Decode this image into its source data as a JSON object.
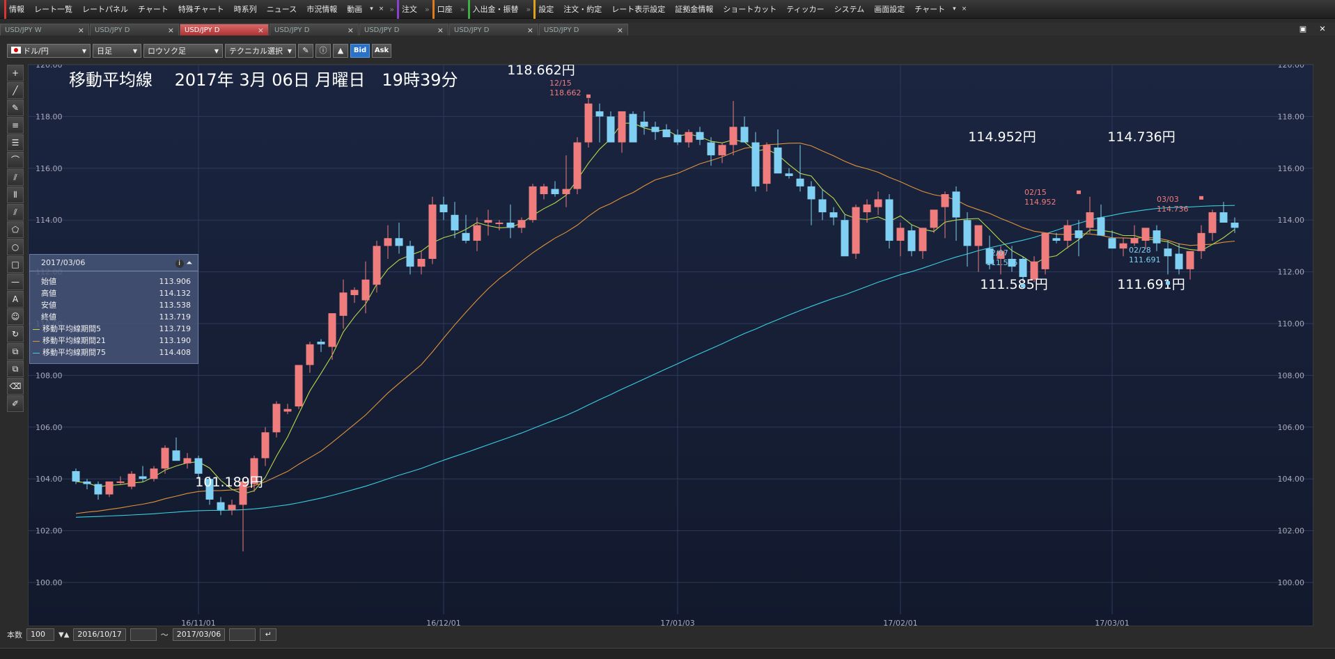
{
  "menubar": {
    "items": [
      {
        "label": "情報",
        "mark": "marked"
      },
      {
        "label": "レート一覧"
      },
      {
        "label": "レートパネル"
      },
      {
        "label": "チャート"
      },
      {
        "label": "特殊チャート"
      },
      {
        "label": "時系列"
      },
      {
        "label": "ニュース"
      },
      {
        "label": "市況情報"
      },
      {
        "label": "動画"
      }
    ],
    "group2": [
      {
        "label": "注文",
        "mark": "marked-purple"
      }
    ],
    "group3": [
      {
        "label": "口座",
        "mark": "marked-orange"
      }
    ],
    "group4": [
      {
        "label": "入出金・振替",
        "mark": "marked-green"
      }
    ],
    "group5": [
      {
        "label": "設定",
        "mark": "marked-gold"
      },
      {
        "label": "注文・約定"
      },
      {
        "label": "レート表示設定"
      },
      {
        "label": "証拠金情報"
      },
      {
        "label": "ショートカット"
      },
      {
        "label": "ティッカー"
      },
      {
        "label": "システム"
      },
      {
        "label": "画面設定"
      },
      {
        "label": "チャート"
      }
    ],
    "close_glyph": "×",
    "caret_glyph": "▾",
    "sep_glyph": "»"
  },
  "tabs": [
    {
      "label": "USD/JPY W",
      "active": false
    },
    {
      "label": "USD/JPY D",
      "active": false
    },
    {
      "label": "USD/JPY D",
      "active": true
    },
    {
      "label": "USD/JPY D",
      "active": false
    },
    {
      "label": "USD/JPY D",
      "active": false
    },
    {
      "label": "USD/JPY D",
      "active": false
    },
    {
      "label": "USD/JPY D",
      "active": false
    }
  ],
  "toolbar": {
    "pair": "ドル/円",
    "period": "日足",
    "chart_type": "ロウソク足",
    "technical": "テクニカル選択",
    "bid": "Bid",
    "ask": "Ask"
  },
  "drawtools": [
    "+",
    "╱",
    "✎",
    "≡",
    "☰",
    "⌒",
    "⫽",
    "⦀",
    "⫽",
    "⬠",
    "○",
    "□",
    "—",
    "A",
    "☺",
    "↻",
    "⧉",
    "⧉",
    "⌫",
    "✐"
  ],
  "annotations": {
    "title": "移動平均線　 2017年 3月 06日 月曜日　19時39分",
    "high1": "118.662円",
    "low1": "101.189円",
    "high2": "114.952円",
    "low2": "111.585円",
    "high3": "114.736円",
    "low3": "111.691円",
    "mark_h1_date": "12/15",
    "mark_h1_val": "118.662",
    "mark_h2_date": "02/15",
    "mark_h2_val": "114.952",
    "mark_h3_date": "03/03",
    "mark_h3_val": "114.736",
    "mark_l2_date": "02/07",
    "mark_l2_val": "111.585",
    "mark_l3_date": "02/28",
    "mark_l3_val": "111.691"
  },
  "infopanel": {
    "date": "2017/03/06",
    "rows": [
      {
        "label": "始値",
        "value": "113.906"
      },
      {
        "label": "高値",
        "value": "114.132"
      },
      {
        "label": "安値",
        "value": "113.538"
      },
      {
        "label": "終値",
        "value": "113.719"
      },
      {
        "label": "移動平均線期間5",
        "value": "113.719",
        "color": "#b8d84a"
      },
      {
        "label": "移動平均線期間21",
        "value": "113.190",
        "color": "#e0943a"
      },
      {
        "label": "移動平均線期間75",
        "value": "114.408",
        "color": "#3ad0e0"
      }
    ]
  },
  "bottombar": {
    "count_label": "本数",
    "count_value": "100",
    "from_date": "2016/10/17",
    "tilde": "～",
    "to_date": "2017/03/06"
  },
  "chart_data": {
    "type": "candlestick",
    "ylim": [
      100,
      120.5
    ],
    "yticks": [
      "120.00",
      "118.00",
      "116.00",
      "114.00",
      "112.00",
      "110.00",
      "108.00",
      "106.00",
      "104.00",
      "102.00",
      "100.00"
    ],
    "yticks_values": [
      120,
      118,
      116,
      114,
      112,
      110,
      108,
      106,
      104,
      102,
      100
    ],
    "xticks": [
      {
        "label": "16/11/01",
        "index": 11
      },
      {
        "label": "16/12/01",
        "index": 33
      },
      {
        "label": "17/01/03",
        "index": 54
      },
      {
        "label": "17/02/01",
        "index": 74
      },
      {
        "label": "17/03/01",
        "index": 93
      }
    ],
    "colors": {
      "up": "#f07d7d",
      "down": "#7fd0f2",
      "ma5": "#b8d84a",
      "ma21": "#e0943a",
      "ma75": "#3ad0e0"
    },
    "candles": [
      [
        104.3,
        104.4,
        103.8,
        103.9
      ],
      [
        103.9,
        104.0,
        103.6,
        103.8
      ],
      [
        103.8,
        103.9,
        103.2,
        103.4
      ],
      [
        103.4,
        103.9,
        103.3,
        103.9
      ],
      [
        103.9,
        104.1,
        103.8,
        103.9
      ],
      [
        103.7,
        104.3,
        103.6,
        104.2
      ],
      [
        104.1,
        104.5,
        103.9,
        104.0
      ],
      [
        104.0,
        104.5,
        103.9,
        104.4
      ],
      [
        104.4,
        105.3,
        104.2,
        105.2
      ],
      [
        105.1,
        105.6,
        104.7,
        104.7
      ],
      [
        104.6,
        105.0,
        104.4,
        104.8
      ],
      [
        104.8,
        104.9,
        104.0,
        104.2
      ],
      [
        104.0,
        104.1,
        103.0,
        103.2
      ],
      [
        103.1,
        103.3,
        102.6,
        102.8
      ],
      [
        102.8,
        103.2,
        102.6,
        103.0
      ],
      [
        103.0,
        104.0,
        101.2,
        103.9
      ],
      [
        103.8,
        104.9,
        103.5,
        104.8
      ],
      [
        104.8,
        106.0,
        104.5,
        105.8
      ],
      [
        105.8,
        107.0,
        105.6,
        106.9
      ],
      [
        106.6,
        106.9,
        106.5,
        106.7
      ],
      [
        106.8,
        108.4,
        106.7,
        108.4
      ],
      [
        108.4,
        109.3,
        108.1,
        109.2
      ],
      [
        109.3,
        109.4,
        108.9,
        109.2
      ],
      [
        109.1,
        110.4,
        108.6,
        110.4
      ],
      [
        110.3,
        111.7,
        109.8,
        111.2
      ],
      [
        111.1,
        111.4,
        110.8,
        111.3
      ],
      [
        110.9,
        112.4,
        110.4,
        111.7
      ],
      [
        111.5,
        113.2,
        111.2,
        113.0
      ],
      [
        113.0,
        113.8,
        112.5,
        113.3
      ],
      [
        113.3,
        113.9,
        112.7,
        113.0
      ],
      [
        113.0,
        113.2,
        111.9,
        112.2
      ],
      [
        112.2,
        112.8,
        111.9,
        112.5
      ],
      [
        112.5,
        114.9,
        112.3,
        114.6
      ],
      [
        114.6,
        114.9,
        114.0,
        114.3
      ],
      [
        114.2,
        114.7,
        113.3,
        113.6
      ],
      [
        113.5,
        114.2,
        113.1,
        113.2
      ],
      [
        113.2,
        114.1,
        112.8,
        113.8
      ],
      [
        113.9,
        114.4,
        113.4,
        114.0
      ],
      [
        113.9,
        114.0,
        113.6,
        113.9
      ],
      [
        113.9,
        114.6,
        113.3,
        113.7
      ],
      [
        113.7,
        114.1,
        113.5,
        114.0
      ],
      [
        114.0,
        115.4,
        113.9,
        115.3
      ],
      [
        115.0,
        115.4,
        114.8,
        115.3
      ],
      [
        115.2,
        115.5,
        114.9,
        115.0
      ],
      [
        115.0,
        116.5,
        114.5,
        115.2
      ],
      [
        115.2,
        117.2,
        115.0,
        117.0
      ],
      [
        117.0,
        118.7,
        116.8,
        118.5
      ],
      [
        118.2,
        118.5,
        117.0,
        118.0
      ],
      [
        118.0,
        118.2,
        117.4,
        117.0
      ],
      [
        117.0,
        117.4,
        116.6,
        118.2
      ],
      [
        118.1,
        118.2,
        117.2,
        117.0
      ],
      [
        117.8,
        118.2,
        117.3,
        117.6
      ],
      [
        117.6,
        117.8,
        117.1,
        117.4
      ],
      [
        117.5,
        117.7,
        117.3,
        117.2
      ],
      [
        117.3,
        117.5,
        116.9,
        117.0
      ],
      [
        117.0,
        117.5,
        116.8,
        117.4
      ],
      [
        117.4,
        117.6,
        116.9,
        117.1
      ],
      [
        117.0,
        117.2,
        116.1,
        116.5
      ],
      [
        116.5,
        117.0,
        116.2,
        116.9
      ],
      [
        116.9,
        118.6,
        116.5,
        117.6
      ],
      [
        117.6,
        118.0,
        117.1,
        117.0
      ],
      [
        117.0,
        117.4,
        115.1,
        115.3
      ],
      [
        115.4,
        117.0,
        115.1,
        116.9
      ],
      [
        116.8,
        117.5,
        115.9,
        115.8
      ],
      [
        115.8,
        116.0,
        115.6,
        115.7
      ],
      [
        115.6,
        116.9,
        115.1,
        115.3
      ],
      [
        115.3,
        115.5,
        113.8,
        114.8
      ],
      [
        114.8,
        115.2,
        114.0,
        114.3
      ],
      [
        114.3,
        114.5,
        113.8,
        114.1
      ],
      [
        114.0,
        114.2,
        112.6,
        112.6
      ],
      [
        112.7,
        114.6,
        112.5,
        114.5
      ],
      [
        114.3,
        114.8,
        113.9,
        114.6
      ],
      [
        114.5,
        115.1,
        114.2,
        114.8
      ],
      [
        114.8,
        115.0,
        112.9,
        113.2
      ],
      [
        113.2,
        113.9,
        112.6,
        113.7
      ],
      [
        113.6,
        113.8,
        112.6,
        112.8
      ],
      [
        112.8,
        113.7,
        112.5,
        113.7
      ],
      [
        113.7,
        114.4,
        113.5,
        114.4
      ],
      [
        114.5,
        115.1,
        113.3,
        115.0
      ],
      [
        115.1,
        115.3,
        113.2,
        114.1
      ],
      [
        114.0,
        114.3,
        112.2,
        113.0
      ],
      [
        113.0,
        113.8,
        112.0,
        113.8
      ],
      [
        112.9,
        113.4,
        112.1,
        112.3
      ],
      [
        112.5,
        113.0,
        111.9,
        112.8
      ],
      [
        112.5,
        113.0,
        112.0,
        112.2
      ],
      [
        112.5,
        112.6,
        111.6,
        111.8
      ],
      [
        111.7,
        112.6,
        111.6,
        112.4
      ],
      [
        112.1,
        113.4,
        111.9,
        113.5
      ],
      [
        113.3,
        113.5,
        113.1,
        113.2
      ],
      [
        113.2,
        114.0,
        112.9,
        113.8
      ],
      [
        113.6,
        114.0,
        112.6,
        113.3
      ],
      [
        113.7,
        114.9,
        113.5,
        114.3
      ],
      [
        114.1,
        114.6,
        113.8,
        113.4
      ],
      [
        113.3,
        113.6,
        112.9,
        112.9
      ],
      [
        112.9,
        113.3,
        112.6,
        113.1
      ],
      [
        113.1,
        113.8,
        113.0,
        113.3
      ],
      [
        113.2,
        113.7,
        112.9,
        113.7
      ],
      [
        113.6,
        113.8,
        112.8,
        113.1
      ],
      [
        112.9,
        113.2,
        111.9,
        112.6
      ],
      [
        112.7,
        113.1,
        111.9,
        112.1
      ],
      [
        112.1,
        112.7,
        111.7,
        112.8
      ],
      [
        112.8,
        113.8,
        112.5,
        113.5
      ],
      [
        113.5,
        114.4,
        113.2,
        114.3
      ],
      [
        114.3,
        114.7,
        113.9,
        113.9
      ],
      [
        113.9,
        114.1,
        113.5,
        113.7
      ]
    ]
  }
}
